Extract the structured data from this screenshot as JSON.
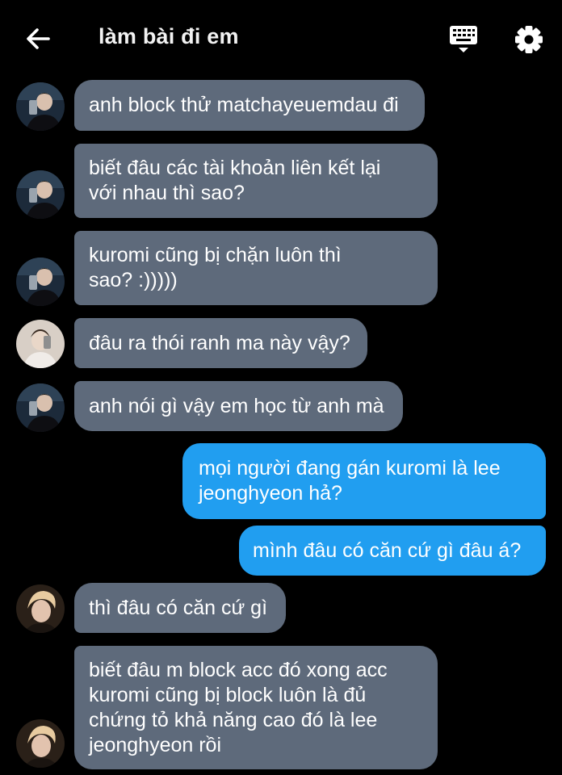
{
  "header": {
    "title": "làm bài đi em",
    "back_icon": "arrow-left-icon",
    "keyboard_icon": "keyboard-icon",
    "settings_icon": "gear-icon"
  },
  "colors": {
    "background": "#000000",
    "received_bubble": "#5e6a7b",
    "sent_bubble": "#219ef0"
  },
  "messages": [
    {
      "direction": "received",
      "text": "anh block thử matchayeuemdau đi"
    },
    {
      "direction": "received",
      "text": "biết đâu các tài khoản liên kết lại\nvới nhau thì sao?"
    },
    {
      "direction": "received",
      "text": "kuromi cũng bị chặn luôn thì\nsao? :)))))"
    },
    {
      "direction": "received",
      "text": "đâu ra thói ranh ma này vậy?"
    },
    {
      "direction": "received",
      "text": "anh nói gì vậy em học từ anh mà"
    },
    {
      "direction": "sent",
      "text": "mọi người đang gán kuromi là lee\njeonghyeon hả?"
    },
    {
      "direction": "sent",
      "text": "mình đâu có căn cứ gì đâu á?"
    },
    {
      "direction": "received",
      "text": "thì đâu có căn cứ gì"
    },
    {
      "direction": "received",
      "text": "biết đâu m block acc đó xong acc\nkuromi cũng bị block luôn là đủ\nchứng tỏ khả năng cao đó là lee\njeonghyeon rồi"
    }
  ]
}
